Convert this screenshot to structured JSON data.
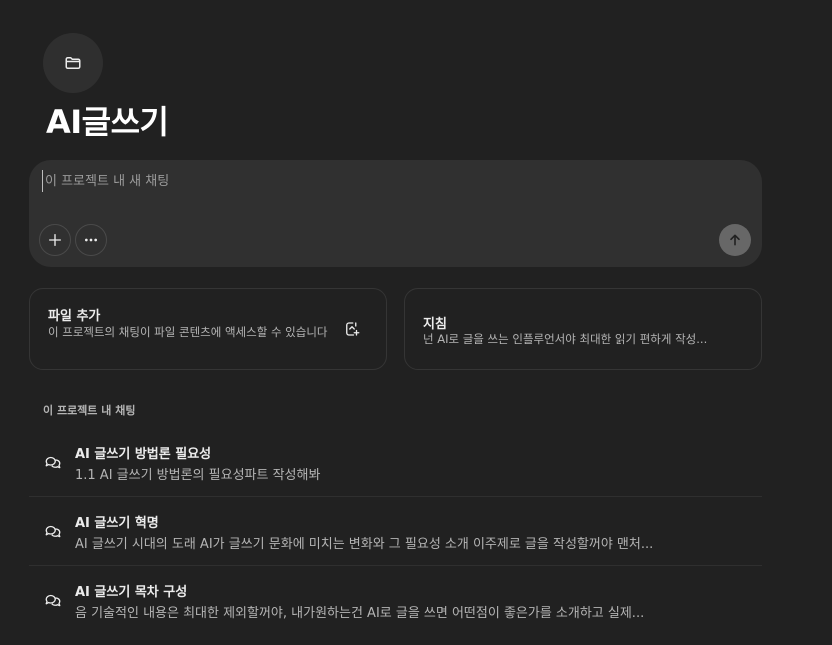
{
  "project": {
    "icon": "folder-icon",
    "title": "AI글쓰기"
  },
  "composer": {
    "placeholder": "이 프로젝트 내 새 채팅",
    "value": "",
    "icons": {
      "add": "plus-icon",
      "more": "more-horizontal-icon",
      "send": "arrow-up-icon"
    }
  },
  "cards": {
    "files": {
      "title": "파일 추가",
      "description": "이 프로젝트의 채팅이 파일 콘텐츠에 액세스할 수 있습니다",
      "icon": "add-file-icon"
    },
    "instructions": {
      "title": "지침",
      "description": "넌 AI로 글을 쓰는 인플루언서야 최대한 읽기 편하게 작성..."
    }
  },
  "chats_section": {
    "label": "이 프로젝트 내 채팅",
    "items": [
      {
        "title": "AI 글쓰기 방법론 필요성",
        "snippet": "1.1 AI 글쓰기 방법론의 필요성파트 작성해봐",
        "icon": "chat-bubbles-icon"
      },
      {
        "title": "AI 글쓰기 혁명",
        "snippet": "AI 글쓰기 시대의 도래 AI가 글쓰기 문화에 미치는 변화와 그 필요성 소개 이주제로 글을 작성할꺼야 맨처...",
        "icon": "chat-bubbles-icon"
      },
      {
        "title": "AI 글쓰기 목차 구성",
        "snippet": "음 기술적인 내용은 최대한 제외할꺼야, 내가원하는건 AI로 글을 쓰면 어떤점이 좋은가를 소개하고 실제...",
        "icon": "chat-bubbles-icon"
      }
    ]
  },
  "colors": {
    "background": "#212121",
    "surface": "#303030",
    "text": "#ececec",
    "muted_text": "#b4b4b4",
    "send_button": "#676767"
  }
}
